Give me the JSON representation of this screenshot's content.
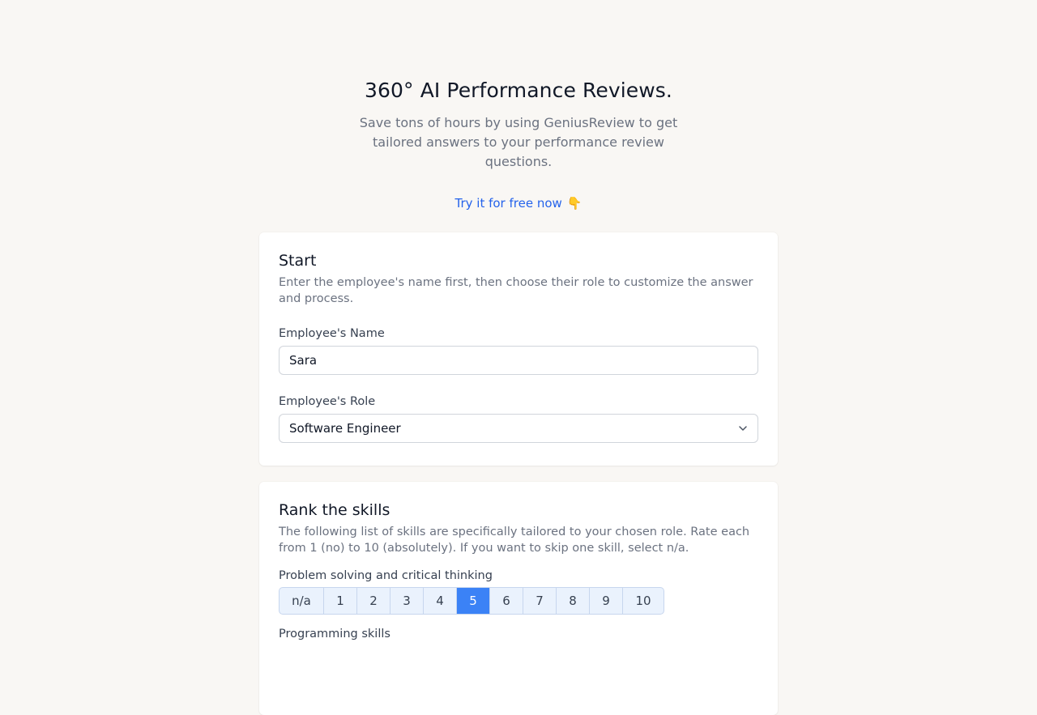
{
  "hero": {
    "title": "360° AI Performance Reviews.",
    "subtitle_line1": "Save tons of hours by using GeniusReview to get",
    "subtitle_line2": "tailored answers to your performance review questions.",
    "cta_label": "Try it for free now",
    "cta_icon": "👇"
  },
  "start": {
    "title": "Start",
    "description": "Enter the employee's name first, then choose their role to customize the answer and process.",
    "name_label": "Employee's Name",
    "name_value": "Sara",
    "role_label": "Employee's Role",
    "role_value": "Software Engineer"
  },
  "skills": {
    "title": "Rank the skills",
    "description": "The following list of skills are specifically tailored to your chosen role. Rate each from 1 (no) to 10 (absolutely). If you want to skip one skill, select n/a.",
    "items": [
      {
        "label": "Problem solving and critical thinking",
        "options": [
          "n/a",
          "1",
          "2",
          "3",
          "4",
          "5",
          "6",
          "7",
          "8",
          "9",
          "10"
        ],
        "selected": "5"
      },
      {
        "label": "Programming skills"
      }
    ]
  },
  "colors": {
    "accent": "#3b82f6",
    "link": "#2563eb",
    "background": "#f9f7f4"
  }
}
